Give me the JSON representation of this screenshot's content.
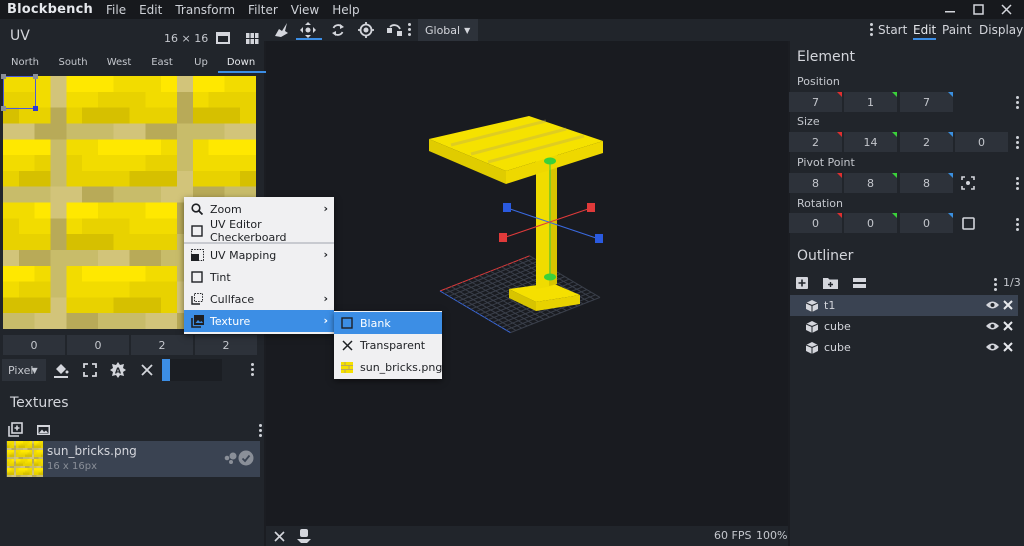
{
  "app": {
    "name": "Blockbench",
    "menu": [
      "File",
      "Edit",
      "Transform",
      "Filter",
      "View",
      "Help"
    ],
    "window_controls": [
      "minimize",
      "maximize",
      "close"
    ]
  },
  "uv_panel": {
    "title": "UV",
    "resolution": "16 × 16",
    "face_tabs": [
      "North",
      "South",
      "West",
      "East",
      "Up",
      "Down"
    ],
    "active_face": "Down",
    "uv_values": [
      "0",
      "0",
      "2",
      "2"
    ],
    "mode_select": "Pixel",
    "tools": [
      "paint-bucket",
      "fullscreen",
      "auto-uv",
      "clear"
    ]
  },
  "textures_panel": {
    "title": "Textures",
    "items": [
      {
        "name": "sun_bricks.png",
        "size": "16 x 16px",
        "selected": true
      }
    ]
  },
  "toolbar": {
    "tools": [
      "vertex-snap",
      "move",
      "rotate",
      "pivot",
      "resize"
    ],
    "active_tool": "move",
    "space_select": "Global",
    "modes": [
      "Start",
      "Edit",
      "Paint",
      "Display"
    ],
    "active_mode": "Edit"
  },
  "context_menu": {
    "items": [
      {
        "label": "Zoom",
        "icon": "search-icon",
        "submenu": true
      },
      {
        "label": "UV Editor Checkerboard",
        "icon": "checkbox-icon",
        "submenu": false
      },
      {
        "label": "UV Mapping",
        "icon": "uv-mapping-icon",
        "submenu": true
      },
      {
        "label": "Tint",
        "icon": "checkbox-icon",
        "submenu": false
      },
      {
        "label": "Cullface",
        "icon": "cullface-icon",
        "submenu": true
      },
      {
        "label": "Texture",
        "icon": "texture-icon",
        "submenu": true,
        "active": true
      }
    ],
    "submenu": [
      {
        "label": "Blank",
        "icon": "checkbox-icon",
        "active": true
      },
      {
        "label": "Transparent",
        "icon": "close-icon"
      },
      {
        "label": "sun_bricks.png",
        "icon": "texture-thumb"
      }
    ]
  },
  "element_panel": {
    "title": "Element",
    "position_label": "Position",
    "position": [
      "7",
      "1",
      "7"
    ],
    "size_label": "Size",
    "size": [
      "2",
      "14",
      "2",
      "0"
    ],
    "pivot_label": "Pivot Point",
    "pivot": [
      "8",
      "8",
      "8"
    ],
    "rotation_label": "Rotation",
    "rotation": [
      "0",
      "0",
      "0"
    ]
  },
  "outliner": {
    "title": "Outliner",
    "count": "1/3",
    "items": [
      {
        "name": "t1",
        "selected": true
      },
      {
        "name": "cube",
        "selected": false
      },
      {
        "name": "cube",
        "selected": false
      }
    ]
  },
  "status": {
    "fps": "60 FPS",
    "zoom": "100%"
  },
  "colors": {
    "accent": "#3c8ee5",
    "axis_x": "#e02f2f",
    "axis_y": "#3ad13a",
    "axis_z": "#3a8fe0",
    "texture_yellow": "#ffe800"
  }
}
